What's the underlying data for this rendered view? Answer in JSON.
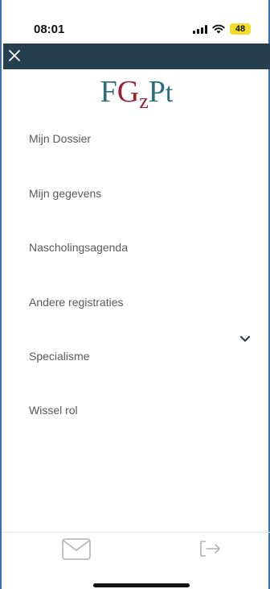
{
  "status_bar": {
    "time": "08:01",
    "battery": "48"
  },
  "logo": {
    "f": "F",
    "g": "G",
    "z": "z",
    "p": "P",
    "t": "t"
  },
  "menu": {
    "items": [
      {
        "label": "Mijn Dossier"
      },
      {
        "label": "Mijn gegevens"
      },
      {
        "label": "Nascholingsagenda"
      },
      {
        "label": "Andere registraties"
      },
      {
        "label": "Specialisme"
      },
      {
        "label": "Wissel rol"
      }
    ]
  },
  "icons": {
    "close": "close-icon",
    "chevron": "chevron-down-icon",
    "mail": "mail-icon",
    "logout": "logout-icon"
  },
  "colors": {
    "header": "#263f4f",
    "logo_teal": "#2a6d7c",
    "logo_red": "#9b2032",
    "battery": "#f3dd2a",
    "menu_text": "#5a5a5a"
  }
}
